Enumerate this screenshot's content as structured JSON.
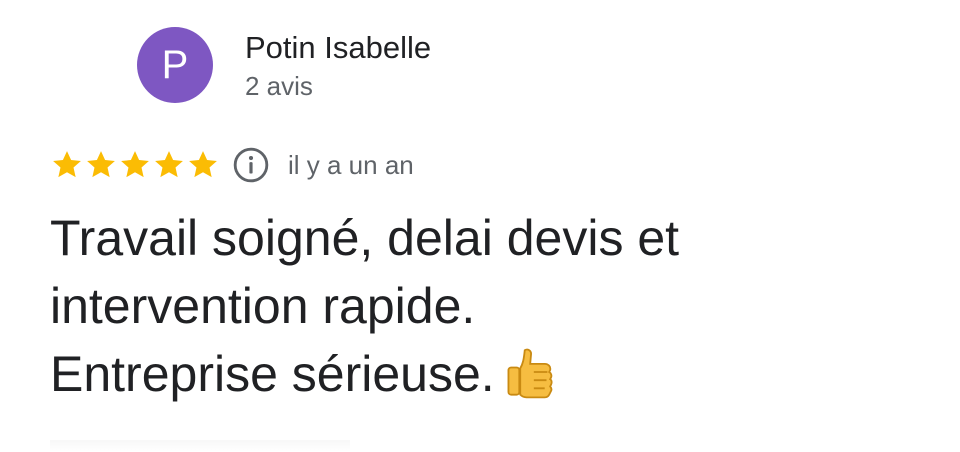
{
  "reviewer": {
    "avatar_initial": "P",
    "avatar_color": "#7e57c2",
    "name": "Potin Isabelle",
    "review_count": "2 avis"
  },
  "rating": {
    "stars": 5,
    "max_stars": 5,
    "star_color": "#fbbc04",
    "info_icon": "info-icon",
    "date": "il y a un an"
  },
  "review": {
    "lines": [
      "Travail soigné, delai devis et",
      "intervention rapide.",
      "Entreprise sérieuse."
    ],
    "emoji": "thumbs-up-icon"
  }
}
